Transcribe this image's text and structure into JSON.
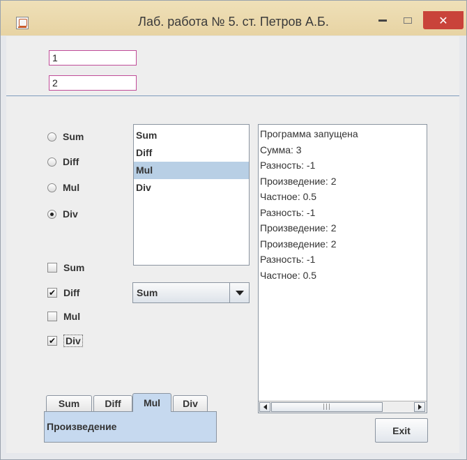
{
  "window": {
    "title": "Лаб. работа № 5. ст. Петров А.Б."
  },
  "inputs": {
    "field1": "1",
    "field2": "2"
  },
  "radios": [
    {
      "label": "Sum",
      "checked": false
    },
    {
      "label": "Diff",
      "checked": false
    },
    {
      "label": "Mul",
      "checked": false
    },
    {
      "label": "Div",
      "checked": true
    }
  ],
  "list": {
    "items": [
      "Sum",
      "Diff",
      "Mul",
      "Div"
    ],
    "selected": "Mul"
  },
  "checkboxes": [
    {
      "label": "Sum",
      "checked": false
    },
    {
      "label": "Diff",
      "checked": true
    },
    {
      "label": "Mul",
      "checked": false
    },
    {
      "label": "Div",
      "checked": true
    }
  ],
  "combo": {
    "value": "Sum"
  },
  "log": {
    "lines": [
      "Программа запущена",
      "Сумма: 3",
      "Разность: -1",
      "Произведение: 2",
      "Частное: 0.5",
      "Разность: -1",
      "Произведение: 2",
      "Произведение: 2",
      "Разность: -1",
      "Частное: 0.5"
    ]
  },
  "tabs": {
    "items": [
      "Sum",
      "Diff",
      "Mul",
      "Div"
    ],
    "active": "Mul",
    "panel_text": "Произведение"
  },
  "buttons": {
    "exit": "Exit",
    "close_glyph": "✕"
  },
  "icons": {
    "app": "java-app-icon",
    "minimize": "minimize-icon",
    "maximize": "maximize-icon",
    "close": "close-icon"
  },
  "colors": {
    "selection": "#b8cfe5",
    "tab_active": "#c6d9ef",
    "field_border": "#c04b98",
    "close_button": "#c9433a"
  }
}
